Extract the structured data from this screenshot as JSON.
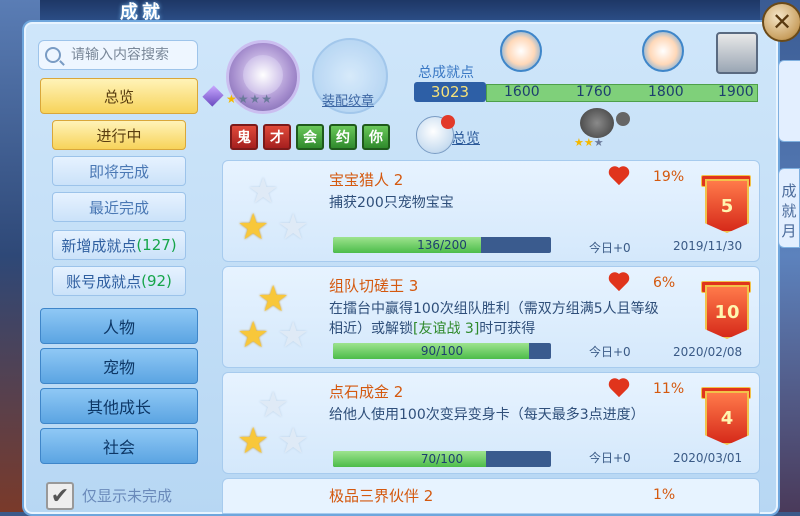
{
  "window": {
    "title": "成就",
    "close_icon": "✕"
  },
  "side_tabs": [
    "成就",
    "成就月"
  ],
  "search": {
    "placeholder": "请输入内容搜索"
  },
  "nav": {
    "overview": "总览",
    "sub": [
      "进行中",
      "即将完成",
      "最近完成"
    ],
    "new_points": {
      "label": "新增成就点",
      "count": "(127)"
    },
    "account_points": {
      "label": "账号成就点",
      "count": "(92)"
    },
    "categories": [
      "人物",
      "宠物",
      "其他成长",
      "社会"
    ]
  },
  "filter": {
    "label": "仅显示未完成",
    "checked": true
  },
  "emblem": {
    "slot_label": "装配纹章",
    "stars_filled": 1,
    "stars_total": 4
  },
  "runes": [
    "鬼",
    "才",
    "会",
    "约",
    "你"
  ],
  "points": {
    "label": "总成就点",
    "value": "3023",
    "milestones": [
      "1600",
      "1760",
      "1800",
      "1900"
    ]
  },
  "summary_link": "总览",
  "achievements": [
    {
      "name": "宝宝猎人 2",
      "desc": "捕获200只宠物宝宝",
      "progress": "136/200",
      "progress_fraction": 0.68,
      "today": "今日+0",
      "date": "2019/11/30",
      "percent": "19%",
      "points": "5",
      "gold_stars": 1
    },
    {
      "name": "组队切磋王 3",
      "desc_part1": "在擂台中赢得100次组队胜利（需双方组满5人且等级相近）或解锁",
      "desc_highlight": "[友谊战 3]",
      "desc_part2": "时可获得",
      "progress": "90/100",
      "progress_fraction": 0.9,
      "today": "今日+0",
      "date": "2020/02/08",
      "percent": "6%",
      "points": "10",
      "gold_stars": 2
    },
    {
      "name": "点石成金 2",
      "desc": "给他人使用100次变异变身卡（每天最多3点进度）",
      "progress": "70/100",
      "progress_fraction": 0.7,
      "today": "今日+0",
      "date": "2020/03/01",
      "percent": "11%",
      "points": "4",
      "gold_stars": 1
    }
  ],
  "next_partial": {
    "name": "极品三界伙伴 2",
    "percent": "1%"
  },
  "colors": {
    "accent": "#d4590f",
    "progress": "#4cbc4a",
    "badge": "#d62a1a"
  }
}
